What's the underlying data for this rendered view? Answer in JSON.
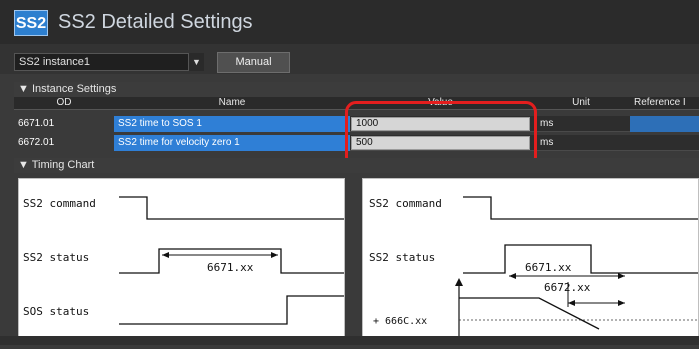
{
  "window": {
    "badge": "SS2",
    "title": "SS2 Detailed Settings"
  },
  "toolbar": {
    "instance_value": "SS2 instance1",
    "manual_label": "Manual"
  },
  "instance_settings": {
    "header": "▼ Instance Settings",
    "columns": [
      "OD",
      "Name",
      "Value",
      "Unit",
      "Reference I"
    ],
    "rows": [
      {
        "od": "6671.01",
        "name": "SS2 time to SOS 1",
        "value": "1000",
        "unit": "ms"
      },
      {
        "od": "6672.01",
        "name": "SS2 time for velocity zero 1",
        "value": "500",
        "unit": "ms"
      }
    ]
  },
  "timing_chart": {
    "header": "▼ Timing Chart",
    "left": {
      "label_command": "SS2 command",
      "label_status": "SS2 status",
      "label_sos": "SOS status",
      "time_label": "6671.xx"
    },
    "right": {
      "label_command": "SS2 command",
      "label_status": "SS2 status",
      "time_label_1": "6671.xx",
      "time_label_2": "6672.xx",
      "velocity_label": "+ 666C.xx"
    }
  },
  "colors": {
    "accent": "#2f7fd6",
    "highlight": "#e31e1e"
  }
}
